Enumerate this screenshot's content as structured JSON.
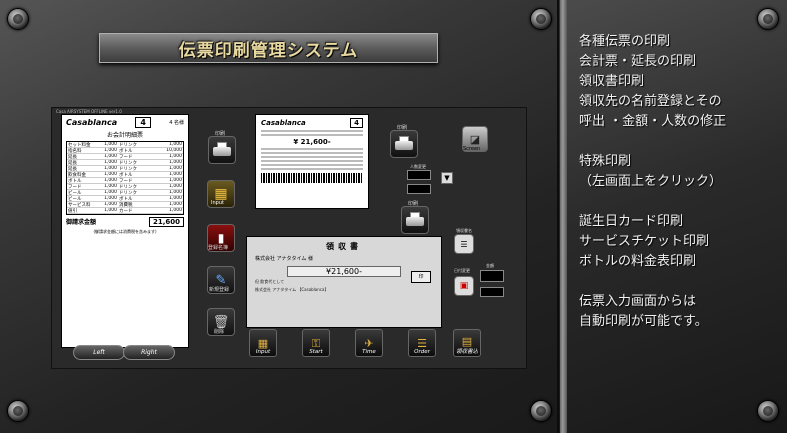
{
  "title": "伝票印刷管理システム",
  "app_caption": "Casa  AIRSYSTEM  OFFLINE ver1.0",
  "left_receipt": {
    "brand": "Casablanca",
    "number": "4",
    "seat": "4 名様",
    "title": "お会計明細票",
    "rows": [
      [
        "セット料金",
        "1,000",
        "ドリンク",
        "1,000"
      ],
      [
        "指名料",
        "1,000",
        "ボトル",
        "10,000"
      ],
      [
        "延長",
        "1,000",
        "フード",
        "1,000"
      ],
      [
        "延長",
        "1,000",
        "ドリンク",
        "1,000"
      ],
      [
        "延長",
        "1,000",
        "ドリンク",
        "1,000"
      ],
      [
        "飲食料金",
        "1,000",
        "ボトル",
        "1,000"
      ],
      [
        "ボトル",
        "1,000",
        "フード",
        "1,000"
      ],
      [
        "フード",
        "1,000",
        "ドリンク",
        "1,000"
      ],
      [
        "ビール",
        "1,000",
        "ドリンク",
        "1,000"
      ],
      [
        "ビール",
        "1,000",
        "ボトル",
        "1,000"
      ],
      [
        "サービス料",
        "1,000",
        "消費税",
        "1,000"
      ],
      [
        "値引",
        "1,000",
        "カード",
        "1,000"
      ]
    ],
    "total_label": "御請求金額",
    "total": "21,600",
    "note": "(御請求金額には消費税を含みます)"
  },
  "top_preview": {
    "brand": "Casablanca",
    "number": "4",
    "amount": "¥ 21,600-"
  },
  "receipt_preview": {
    "title": "領収書",
    "to": "株式会社 アナタタイム 様",
    "amount": "¥21,600-",
    "memo": "但 飲食代として",
    "issuer": "株式会社 アナタタイム 【Casablanca】",
    "stamp": "印"
  },
  "side_buttons": {
    "print1": "印刷",
    "input": "Input",
    "register_name": "登録名簿",
    "new_register": "新規登録",
    "delete": "削除",
    "print2": "印刷",
    "print3": "印刷",
    "screen": "Screen"
  },
  "small_labels": {
    "count": "人数変更",
    "receipt_name": "領収書名",
    "date_change": "日付変更",
    "amount_box": "金額"
  },
  "nav": {
    "left": "Left",
    "right": "Right"
  },
  "bottom_buttons": [
    {
      "label": "Input",
      "glyph": "▦"
    },
    {
      "label": "Start",
      "glyph": "⚿"
    },
    {
      "label": "Time",
      "glyph": "✈"
    },
    {
      "label": "Order",
      "glyph": "☰"
    },
    {
      "label": "領収書込",
      "glyph": "▤"
    }
  ],
  "description": [
    "各種伝票の印刷",
    "会計票・延長の印刷",
    "領収書印刷",
    "領収先の名前登録とその",
    "呼出 ・金額・人数の修正",
    "",
    "特殊印刷",
    "（左画面上をクリック）",
    "",
    "誕生日カード印刷",
    "サービスチケット印刷",
    "ボトルの料金表印刷",
    "",
    "伝票入力画面からは",
    "自動印刷が可能です。"
  ]
}
